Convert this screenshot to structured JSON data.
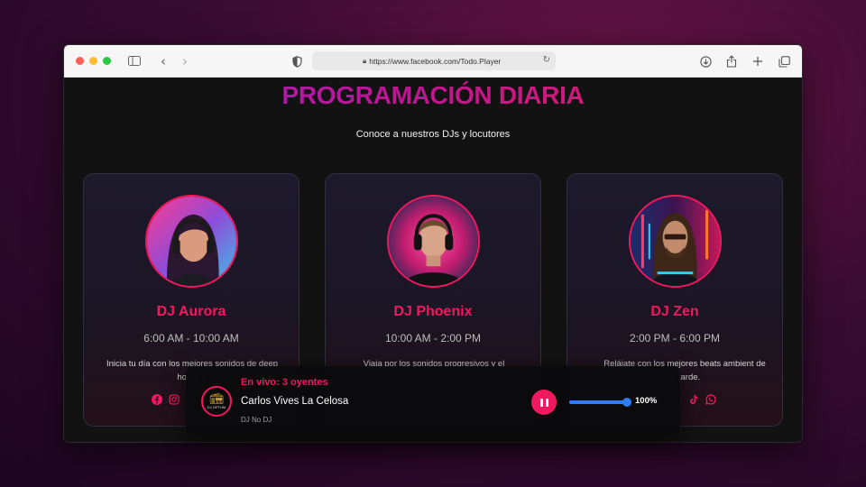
{
  "browser": {
    "url": "https://www.facebook.com/Todo.Player",
    "icons": [
      "sidebar-icon",
      "chevron-left-icon",
      "chevron-right-icon",
      "shield-icon",
      "lock-icon",
      "reload-icon",
      "download-icon",
      "share-icon",
      "plus-icon",
      "tabs-icon"
    ]
  },
  "page": {
    "title": "PROGRAMACIÓN DIARIA",
    "subtitle": "Conoce a nuestros DJs y locutores"
  },
  "djs": [
    {
      "name": "DJ Aurora",
      "time": "6:00 AM - 10:00 AM",
      "description": "Inicia tu día con los mejores sonidos de deep house y",
      "socials": [
        "facebook-icon",
        "instagram-icon"
      ]
    },
    {
      "name": "DJ Phoenix",
      "time": "10:00 AM - 2:00 PM",
      "description": "Viaja por los sonidos progresivos y el",
      "socials": []
    },
    {
      "name": "DJ Zen",
      "time": "2:00 PM - 6:00 PM",
      "description": "Relájate con los mejores beats ambient de la tarde.",
      "socials": [
        "tiktok-icon",
        "whatsapp-icon"
      ]
    }
  ],
  "player": {
    "live_status": "En vivo: 3 oyentes",
    "song": "Carlos Vives La Celosa",
    "dj": "DJ No DJ",
    "volume": 1.0,
    "volume_label": "100%",
    "logo_text": "DJ OPTUM",
    "icons": [
      "radio-icon",
      "pause-icon"
    ]
  },
  "colors": {
    "accent": "#f2185f",
    "title_gradient_start": "#9b1bc7",
    "title_gradient_end": "#e71f5c",
    "volume": "#2f7df6"
  }
}
